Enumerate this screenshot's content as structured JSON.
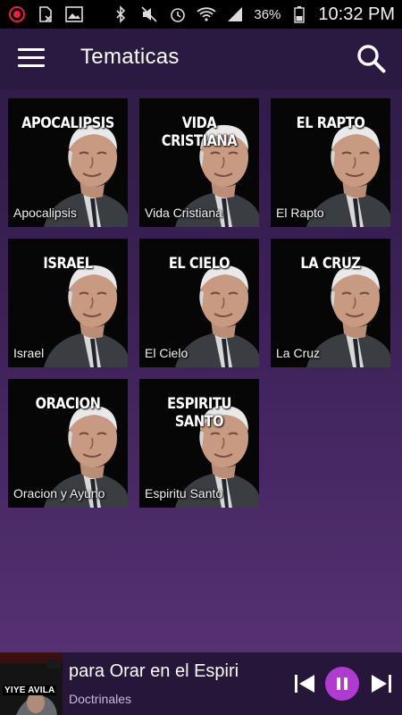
{
  "status_bar": {
    "icons_left": [
      "record-icon",
      "sim-blocked-icon",
      "image-icon"
    ],
    "icons_right": [
      "bluetooth-icon",
      "mute-icon",
      "alarm-icon",
      "wifi-icon",
      "signal-icon"
    ],
    "battery": "36%",
    "time": "10:32 PM"
  },
  "app_bar": {
    "title": "Tematicas",
    "menu_icon": "hamburger-menu-icon",
    "search_icon": "search-icon"
  },
  "tiles": [
    {
      "heading": "APOCALIPSIS",
      "caption": "Apocalipsis"
    },
    {
      "heading": "VIDA CRISTIANA",
      "caption": "Vida Cristiana"
    },
    {
      "heading": "EL RAPTO",
      "caption": "El Rapto"
    },
    {
      "heading": "ISRAEL",
      "caption": "Israel"
    },
    {
      "heading": "EL CIELO",
      "caption": "El Cielo"
    },
    {
      "heading": "LA CRUZ",
      "caption": "La Cruz"
    },
    {
      "heading": "ORACION",
      "caption": "Oracion y Ayuno"
    },
    {
      "heading": "ESPIRITU SANTO",
      "caption": "Espiritu Santo"
    }
  ],
  "player": {
    "art_label": "YIYE AVILA",
    "title": "para Orar en el Espiri",
    "subtitle": "Doctrinales",
    "accent": "#b13ad1"
  }
}
